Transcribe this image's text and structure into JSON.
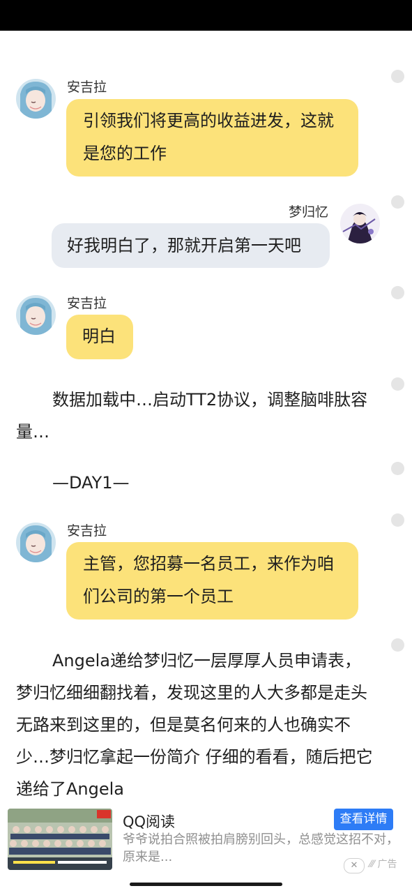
{
  "messages": [
    {
      "speaker": "安吉拉",
      "text": "引领我们将更高的收益进发，这就是您的工作"
    },
    {
      "speaker": "梦归忆",
      "text": "好我明白了，那就开启第一天吧"
    },
    {
      "speaker": "安吉拉",
      "text": "明白"
    },
    {
      "narration": "数据加载中…启动TT2协议，调整脑啡肽容量…"
    },
    {
      "narration": "—DAY1—"
    },
    {
      "speaker": "安吉拉",
      "text": "主管，您招募一名员工，来作为咱们公司的第一个员工"
    },
    {
      "narration": "Angela递给梦归忆一层厚厚人员申请表，梦归忆细细翻找着，发现这里的人大多都是走头无路来到这里的，但是莫名何来的人也确实不少…梦归忆拿起一份简介 仔细的看看，随后把它递给了Angela"
    }
  ],
  "ad": {
    "source": "QQ阅读",
    "button": "查看详情",
    "description": "爷爷说拍合照被拍肩膀别回头，总感觉这招不对，原来是...",
    "close": "✕",
    "label": "广告",
    "thumbnail_icon": "group-photo-thumbnail"
  },
  "colors": {
    "bubble_other": "#fce27a",
    "bubble_self": "#e7ebf1",
    "ad_button": "#2d7cf6"
  }
}
